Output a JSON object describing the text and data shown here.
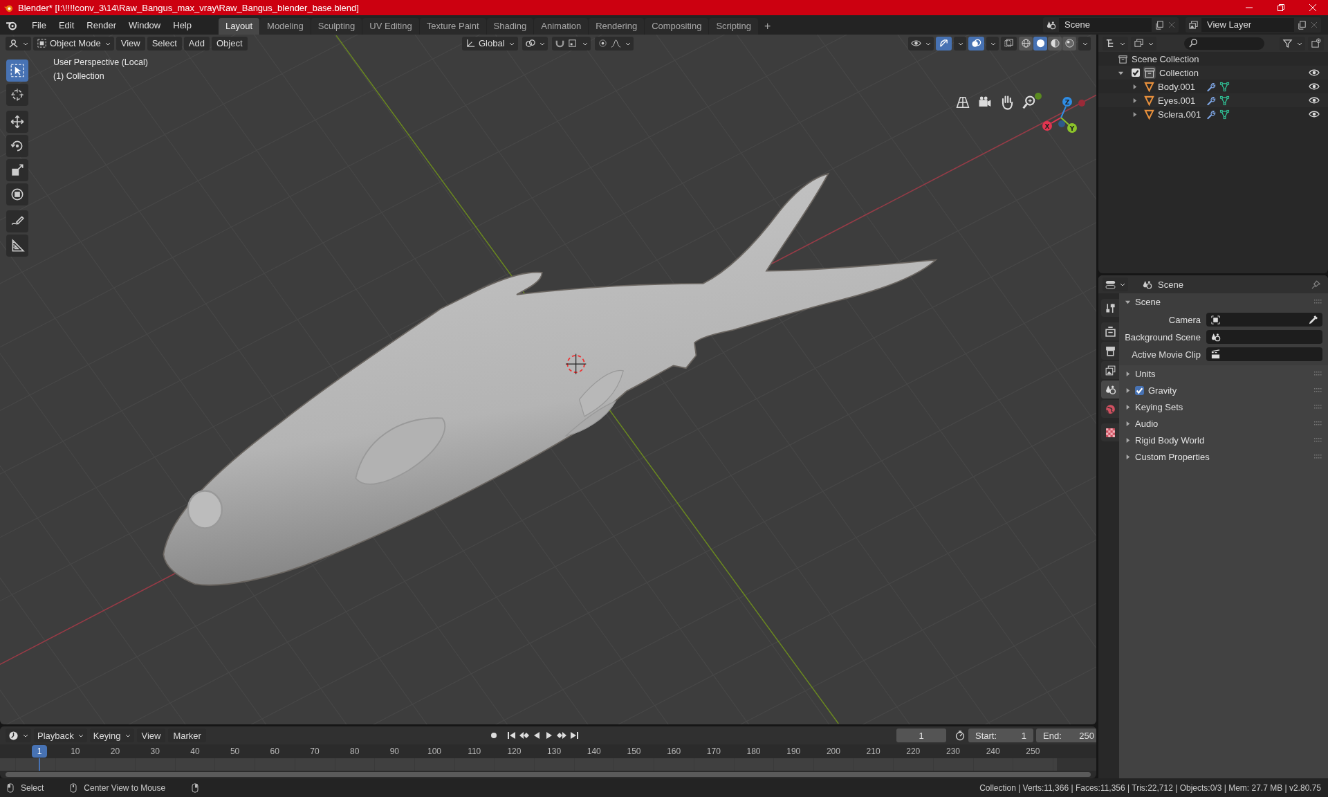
{
  "window": {
    "title": "Blender* [I:\\!!!!conv_3\\14\\Raw_Bangus_max_vray\\Raw_Bangus_blender_base.blend]"
  },
  "menu": [
    "File",
    "Edit",
    "Render",
    "Window",
    "Help"
  ],
  "workspaces": [
    {
      "label": "Layout",
      "selected": true
    },
    {
      "label": "Modeling",
      "selected": false
    },
    {
      "label": "Sculpting",
      "selected": false
    },
    {
      "label": "UV Editing",
      "selected": false
    },
    {
      "label": "Texture Paint",
      "selected": false
    },
    {
      "label": "Shading",
      "selected": false
    },
    {
      "label": "Animation",
      "selected": false
    },
    {
      "label": "Rendering",
      "selected": false
    },
    {
      "label": "Compositing",
      "selected": false
    },
    {
      "label": "Scripting",
      "selected": false
    }
  ],
  "add_workspace": "+",
  "scene_field": "Scene",
  "view_layer_field": "View Layer",
  "viewport": {
    "mode": "Object Mode",
    "menus": [
      "View",
      "Select",
      "Add",
      "Object"
    ],
    "orientation": "Global",
    "overlay_text": [
      "User Perspective (Local)",
      "(1) Collection"
    ],
    "tools": [
      {
        "kind": "select",
        "selected": true
      },
      {
        "kind": "cursor",
        "selected": false
      },
      {
        "kind": "move",
        "selected": false
      },
      {
        "kind": "rotate",
        "selected": false
      },
      {
        "kind": "scale",
        "selected": false
      },
      {
        "kind": "transform",
        "selected": false
      },
      {
        "kind": "annotate",
        "selected": false
      },
      {
        "kind": "measure",
        "selected": false
      }
    ],
    "shading": [
      {
        "kind": "wireframe",
        "selected": false
      },
      {
        "kind": "solid",
        "selected": true
      },
      {
        "kind": "material",
        "selected": false
      },
      {
        "kind": "rendered",
        "selected": false
      }
    ],
    "gizmo_labels": [
      "X",
      "Y",
      "Z"
    ]
  },
  "outliner": {
    "root": "Scene Collection",
    "items": [
      {
        "label": "Collection",
        "checked": true,
        "expanded": true,
        "children": [
          {
            "label": "Body.001",
            "expanded": false
          },
          {
            "label": "Eyes.001",
            "expanded": false
          },
          {
            "label": "Sclera.001",
            "expanded": false
          }
        ]
      }
    ]
  },
  "properties": {
    "header": "Scene",
    "tabs": [
      {
        "kind": "tool",
        "selected": false
      },
      {
        "kind": "render",
        "selected": false
      },
      {
        "kind": "output",
        "selected": false
      },
      {
        "kind": "view-layer",
        "selected": false
      },
      {
        "kind": "scene",
        "selected": true
      },
      {
        "kind": "world",
        "selected": false
      },
      {
        "kind": "texture",
        "selected": false
      }
    ],
    "panels": [
      {
        "kind": "plain",
        "label": "Scene",
        "expanded": true,
        "fields": [
          {
            "kind": "camera",
            "label": "Camera"
          },
          {
            "kind": "scene",
            "label": "Background Scene"
          },
          {
            "kind": "clip",
            "label": "Active Movie Clip"
          }
        ]
      },
      {
        "kind": "plain",
        "label": "Units",
        "expanded": false
      },
      {
        "kind": "checkbox",
        "label": "Gravity",
        "expanded": false,
        "checked": true
      },
      {
        "kind": "plain",
        "label": "Keying Sets",
        "expanded": false
      },
      {
        "kind": "plain",
        "label": "Audio",
        "expanded": false
      },
      {
        "kind": "plain",
        "label": "Rigid Body World",
        "expanded": false
      },
      {
        "kind": "plain",
        "label": "Custom Properties",
        "expanded": false
      }
    ]
  },
  "timeline": {
    "menus": [
      "Playback",
      "Keying",
      "View",
      "Marker"
    ],
    "current_frame": "1",
    "start_label": "Start:",
    "start": "1",
    "end_label": "End:",
    "end": "250",
    "playhead": "1",
    "ruler": [
      "10",
      "20",
      "30",
      "40",
      "50",
      "60",
      "70",
      "80",
      "90",
      "100",
      "110",
      "120",
      "130",
      "140",
      "150",
      "160",
      "170",
      "180",
      "190",
      "200",
      "210",
      "220",
      "230",
      "240",
      "250"
    ]
  },
  "status_bar": {
    "hints": [
      {
        "kind": "left",
        "label": "Select"
      },
      {
        "kind": "middle",
        "label": "Center View to Mouse"
      },
      {
        "kind": "right"
      }
    ],
    "stats": "Collection | Verts:11,366 | Faces:11,356 | Tris:22,712 | Objects:0/3 | Mem: 27.7 MB | v2.80.75"
  }
}
